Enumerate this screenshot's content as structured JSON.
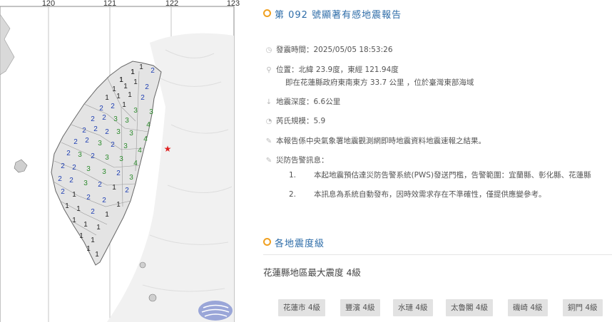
{
  "map": {
    "longitude_ticks": [
      "120",
      "121",
      "122",
      "123"
    ],
    "intensity_labels": [
      {
        "v": "1",
        "c": "#222"
      },
      {
        "v": "1",
        "c": "#222"
      },
      {
        "v": "1",
        "c": "#222"
      },
      {
        "v": "2",
        "c": "#1f3fb3"
      },
      {
        "v": "1",
        "c": "#222"
      },
      {
        "v": "1",
        "c": "#222"
      },
      {
        "v": "1",
        "c": "#222"
      },
      {
        "v": "2",
        "c": "#1f3fb3"
      },
      {
        "v": "1",
        "c": "#222"
      },
      {
        "v": "1",
        "c": "#222"
      },
      {
        "v": "1",
        "c": "#222"
      },
      {
        "v": "2",
        "c": "#1f3fb3"
      },
      {
        "v": "2",
        "c": "#1f3fb3"
      },
      {
        "v": "2",
        "c": "#1f3fb3"
      },
      {
        "v": "1",
        "c": "#222"
      },
      {
        "v": "3",
        "c": "#2e8b2e"
      },
      {
        "v": "3",
        "c": "#2e8b2e"
      },
      {
        "v": "2",
        "c": "#1f3fb3"
      },
      {
        "v": "2",
        "c": "#1f3fb3"
      },
      {
        "v": "3",
        "c": "#2e8b2e"
      },
      {
        "v": "3",
        "c": "#2e8b2e"
      },
      {
        "v": "4",
        "c": "#2e8b2e"
      },
      {
        "v": "2",
        "c": "#1f3fb3"
      },
      {
        "v": "2",
        "c": "#1f3fb3"
      },
      {
        "v": "2",
        "c": "#1f3fb3"
      },
      {
        "v": "3",
        "c": "#2e8b2e"
      },
      {
        "v": "3",
        "c": "#2e8b2e"
      },
      {
        "v": "4",
        "c": "#2e8b2e"
      },
      {
        "v": "2",
        "c": "#1f3fb3"
      },
      {
        "v": "2",
        "c": "#1f3fb3"
      },
      {
        "v": "3",
        "c": "#2e8b2e"
      },
      {
        "v": "2",
        "c": "#1f3fb3"
      },
      {
        "v": "3",
        "c": "#2e8b2e"
      },
      {
        "v": "4",
        "c": "#2e8b2e"
      },
      {
        "v": "2",
        "c": "#1f3fb3"
      },
      {
        "v": "3",
        "c": "#2e8b2e"
      },
      {
        "v": "2",
        "c": "#1f3fb3"
      },
      {
        "v": "3",
        "c": "#2e8b2e"
      },
      {
        "v": "3",
        "c": "#2e8b2e"
      },
      {
        "v": "4",
        "c": "#2e8b2e"
      },
      {
        "v": "2",
        "c": "#1f3fb3"
      },
      {
        "v": "2",
        "c": "#1f3fb3"
      },
      {
        "v": "3",
        "c": "#2e8b2e"
      },
      {
        "v": "3",
        "c": "#2e8b2e"
      },
      {
        "v": "2",
        "c": "#1f3fb3"
      },
      {
        "v": "3",
        "c": "#2e8b2e"
      },
      {
        "v": "2",
        "c": "#1f3fb3"
      },
      {
        "v": "2",
        "c": "#1f3fb3"
      },
      {
        "v": "3",
        "c": "#2e8b2e"
      },
      {
        "v": "2",
        "c": "#1f3fb3"
      },
      {
        "v": "1",
        "c": "#222"
      },
      {
        "v": "2",
        "c": "#1f3fb3"
      },
      {
        "v": "2",
        "c": "#1f3fb3"
      },
      {
        "v": "1",
        "c": "#222"
      },
      {
        "v": "2",
        "c": "#1f3fb3"
      },
      {
        "v": "2",
        "c": "#1f3fb3"
      },
      {
        "v": "1",
        "c": "#222"
      },
      {
        "v": "1",
        "c": "#222"
      },
      {
        "v": "1",
        "c": "#222"
      },
      {
        "v": "2",
        "c": "#1f3fb3"
      },
      {
        "v": "1",
        "c": "#222"
      },
      {
        "v": "1",
        "c": "#222"
      },
      {
        "v": "1",
        "c": "#222"
      },
      {
        "v": "1",
        "c": "#222"
      },
      {
        "v": "1",
        "c": "#222"
      },
      {
        "v": "1",
        "c": "#222"
      },
      {
        "v": "1",
        "c": "#222"
      },
      {
        "v": "1",
        "c": "#222"
      },
      {
        "v": "1",
        "c": "#222"
      },
      {
        "v": "1",
        "c": "#222"
      }
    ]
  },
  "report": {
    "title": "第 092 號顯著有感地震報告",
    "time": "發震時間：2025/05/05 18:53:26",
    "location": "位置：北緯 23.9度，東經 121.94度",
    "location_detail": "即在花蓮縣政府東南東方 33.7 公里 ，位於臺灣東部海域",
    "depth": "地震深度：6.6公里",
    "magnitude": "芮氏規模：5.9",
    "note": "本報告係中央氣象署地震觀測網即時地震資料地震速報之結果。",
    "alert_title": "災防告警訊息：",
    "alert_items": [
      {
        "num": "1.",
        "text": "本起地震預估達災防告警系統(PWS)發送門檻，告警範圍：宜蘭縣、彰化縣、花蓮縣"
      },
      {
        "num": "2.",
        "text": "本訊息為系統自動發布，因時效需求存在不準確性，僅提供應變參考。"
      }
    ]
  },
  "intensity_section": {
    "title": "各地震度級",
    "region_max": "花蓮縣地區最大震度 4級",
    "stations": [
      "花蓮市 4級",
      "豐濱 4級",
      "水璉 4級",
      "太魯閣 4級",
      "磯崎 4級",
      "銅門 4級"
    ]
  },
  "colors": {
    "accent": "#2d6ca8",
    "ring": "#f0a020",
    "epicenter": "#e02020",
    "level_1": "#222222",
    "level_2": "#1f3fb3",
    "level_3_4": "#2e8b2e"
  }
}
